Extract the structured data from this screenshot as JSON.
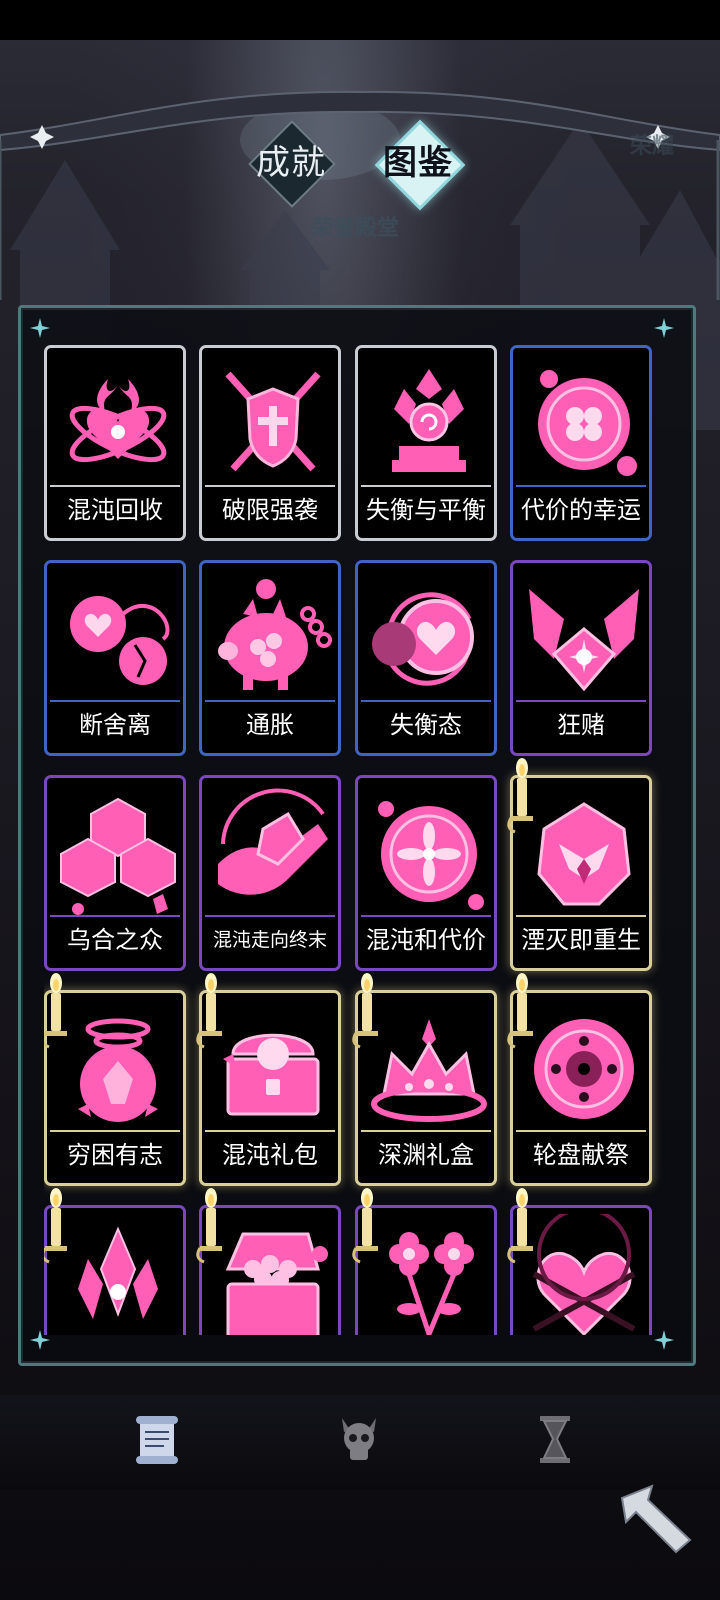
{
  "tabs": [
    {
      "label": "成就",
      "selected": false
    },
    {
      "label": "图鉴",
      "selected": true
    }
  ],
  "hall_label": "荣誉殿堂",
  "side_label": "荣耀",
  "colors": {
    "card_art": "#ff5fb4",
    "tier_white": "#c9ccd2",
    "tier_blue": "#3f64c4",
    "tier_purple": "#7a47c0",
    "tier_gold": "#d8cf9a"
  },
  "cards": [
    {
      "name": "混沌回收",
      "tier": "white",
      "icon": "flaming-heart-orbit-icon",
      "candle": false
    },
    {
      "name": "破限强袭",
      "tier": "white",
      "icon": "shield-crossed-swords-icon",
      "candle": false
    },
    {
      "name": "失衡与平衡",
      "tier": "white",
      "icon": "crystal-altar-icon",
      "candle": false
    },
    {
      "name": "代价的幸运",
      "tier": "blue",
      "icon": "clover-coin-icon",
      "candle": false
    },
    {
      "name": "断舍离",
      "tier": "blue",
      "icon": "broken-heart-orbs-icon",
      "candle": false
    },
    {
      "name": "通胀",
      "tier": "blue",
      "icon": "piggy-bank-chain-icon",
      "candle": false
    },
    {
      "name": "失衡态",
      "tier": "blue",
      "icon": "heart-coin-swirl-icon",
      "candle": false
    },
    {
      "name": "狂赌",
      "tier": "purple",
      "icon": "hands-heart-gem-icon",
      "candle": false
    },
    {
      "name": "乌合之众",
      "tier": "purple",
      "icon": "dice-cluster-icon",
      "candle": false
    },
    {
      "name": "混沌走向终末",
      "tier": "purple",
      "icon": "hand-crystal-icon",
      "candle": false
    },
    {
      "name": "混沌和代价",
      "tier": "purple",
      "icon": "mandala-disc-icon",
      "candle": false
    },
    {
      "name": "湮灭即重生",
      "tier": "gold",
      "icon": "phoenix-gem-icon",
      "candle": true
    },
    {
      "name": "穷困有志",
      "tier": "gold",
      "icon": "vortex-gem-icon",
      "candle": true
    },
    {
      "name": "混沌礼包",
      "tier": "gold",
      "icon": "treasure-chest-icon",
      "candle": true
    },
    {
      "name": "深渊礼盒",
      "tier": "gold",
      "icon": "crown-icon",
      "candle": true
    },
    {
      "name": "轮盘献祭",
      "tier": "gold",
      "icon": "roulette-icon",
      "candle": true
    },
    {
      "name": "",
      "tier": "purple",
      "icon": "crystal-cluster-icon",
      "candle": true
    },
    {
      "name": "",
      "tier": "purple",
      "icon": "open-chest-icon",
      "candle": true
    },
    {
      "name": "",
      "tier": "purple",
      "icon": "flowers-icon",
      "candle": true
    },
    {
      "name": "",
      "tier": "purple",
      "icon": "chained-heart-icon",
      "candle": true
    }
  ],
  "bottom_nav": [
    {
      "icon": "scroll-icon",
      "active": true
    },
    {
      "icon": "skull-icon",
      "active": false
    },
    {
      "icon": "hourglass-icon",
      "active": false
    }
  ],
  "back_button_icon": "back-arrow-icon"
}
